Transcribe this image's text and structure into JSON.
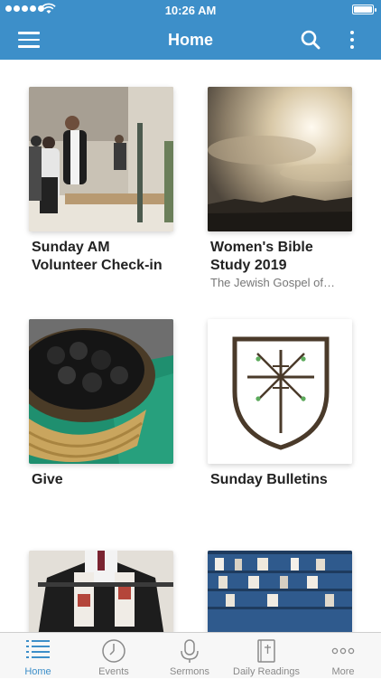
{
  "status_bar": {
    "time": "10:26 AM"
  },
  "navbar": {
    "title": "Home"
  },
  "cards": [
    {
      "title": "Sunday AM Volunteer Check-in",
      "subtitle": ""
    },
    {
      "title": "Women's Bible Study 2019",
      "subtitle": "The Jewish Gospel of…"
    },
    {
      "title": "Give",
      "subtitle": ""
    },
    {
      "title": "Sunday Bulletins",
      "subtitle": ""
    },
    {
      "title": "",
      "subtitle": ""
    },
    {
      "title": "",
      "subtitle": ""
    }
  ],
  "tabs": [
    {
      "label": "Home",
      "icon": "list-icon",
      "active": true
    },
    {
      "label": "Events",
      "icon": "clock-icon",
      "active": false
    },
    {
      "label": "Sermons",
      "icon": "microphone-icon",
      "active": false
    },
    {
      "label": "Daily Readings",
      "icon": "bible-icon",
      "active": false
    },
    {
      "label": "More",
      "icon": "more-icon",
      "active": false
    }
  ],
  "colors": {
    "accent": "#3d8fc9",
    "tab_inactive": "#8a8a8a"
  }
}
